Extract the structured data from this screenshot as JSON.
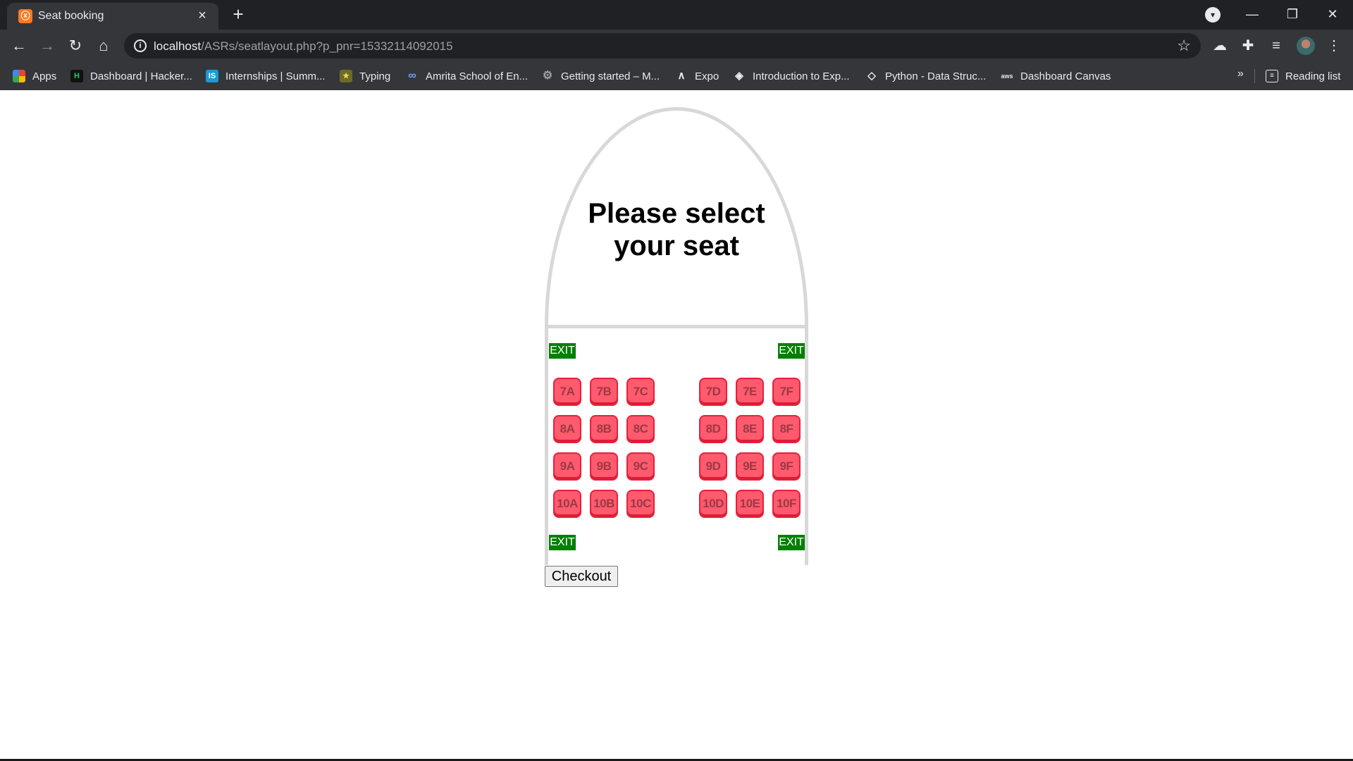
{
  "browser": {
    "tab_title": "Seat booking",
    "tab_favicon": "xampp-icon",
    "new_tab_label": "+",
    "url_host": "localhost",
    "url_path": "/ASRs/seatlayout.php?p_pnr=15332114092015"
  },
  "bookmarks": {
    "items": [
      {
        "label": "Apps",
        "icon": "apps-grid-icon"
      },
      {
        "label": "Dashboard | Hacker...",
        "icon": "hackerrank-icon"
      },
      {
        "label": "Internships | Summ...",
        "icon": "internshala-icon"
      },
      {
        "label": "Typing",
        "icon": "typing-icon"
      },
      {
        "label": "Amrita School of En...",
        "icon": "amrita-icon"
      },
      {
        "label": "Getting started – M...",
        "icon": "gear-icon"
      },
      {
        "label": "Expo",
        "icon": "expo-icon"
      },
      {
        "label": "Introduction to Exp...",
        "icon": "expo-docs-icon"
      },
      {
        "label": "Python - Data Struc...",
        "icon": "python-icon"
      },
      {
        "label": "Dashboard Canvas",
        "icon": "aws-icon"
      }
    ],
    "overflow": "»",
    "reading_list": "Reading list"
  },
  "page": {
    "heading": "Please select your seat",
    "exit_label": "EXIT",
    "checkout_label": "Checkout",
    "colors": {
      "seat_fill": "#ff5a6e",
      "seat_border": "#e8203c",
      "exit": "#008000",
      "fuselage": "#d8d8d8"
    }
  },
  "seats": {
    "rows": [
      {
        "left": [
          "7A",
          "7B",
          "7C"
        ],
        "right": [
          "7D",
          "7E",
          "7F"
        ]
      },
      {
        "left": [
          "8A",
          "8B",
          "8C"
        ],
        "right": [
          "8D",
          "8E",
          "8F"
        ]
      },
      {
        "left": [
          "9A",
          "9B",
          "9C"
        ],
        "right": [
          "9D",
          "9E",
          "9F"
        ]
      },
      {
        "left": [
          "10A",
          "10B",
          "10C"
        ],
        "right": [
          "10D",
          "10E",
          "10F"
        ]
      }
    ]
  }
}
